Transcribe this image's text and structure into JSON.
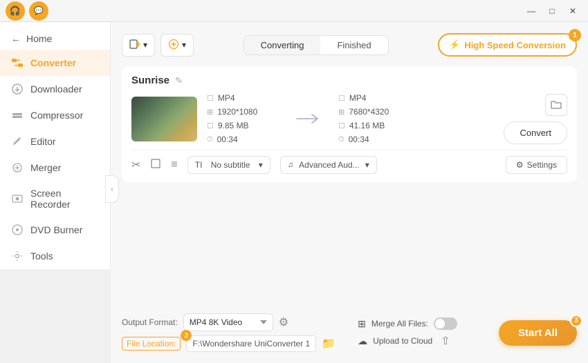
{
  "titlebar": {
    "icon1_label": "headphone-icon",
    "icon2_label": "message-icon",
    "minimize_label": "—",
    "maximize_label": "□",
    "close_label": "✕"
  },
  "sidebar": {
    "home_label": "Home",
    "items": [
      {
        "id": "converter",
        "label": "Converter",
        "icon": "⟳",
        "active": true
      },
      {
        "id": "downloader",
        "label": "Downloader",
        "icon": "↓"
      },
      {
        "id": "compressor",
        "label": "Compressor",
        "icon": "⊟"
      },
      {
        "id": "editor",
        "label": "Editor",
        "icon": "✏"
      },
      {
        "id": "merger",
        "label": "Merger",
        "icon": "⊕"
      },
      {
        "id": "screen-recorder",
        "label": "Screen Recorder",
        "icon": "▶"
      },
      {
        "id": "dvd-burner",
        "label": "DVD Burner",
        "icon": "💿"
      },
      {
        "id": "tools",
        "label": "Tools",
        "icon": "⚙"
      }
    ]
  },
  "header": {
    "add_btn_label": "Add",
    "add_more_label": "+",
    "tab_converting": "Converting",
    "tab_finished": "Finished",
    "high_speed_label": "High Speed Conversion",
    "high_speed_badge": "1",
    "bolt_icon": "⚡"
  },
  "file_card": {
    "title": "Sunrise",
    "source": {
      "format": "MP4",
      "resolution": "1920*1080",
      "size": "9.85 MB",
      "duration": "00:34"
    },
    "dest": {
      "format": "MP4",
      "resolution": "7680*4320",
      "size": "41.16 MB",
      "duration": "00:34"
    },
    "subtitle_label": "No subtitle",
    "audio_label": "Advanced Aud...",
    "settings_label": "Settings"
  },
  "bottom": {
    "output_format_label": "Output Format:",
    "output_format_value": "MP4 8K Video",
    "file_location_label": "File Location:",
    "file_location_value": "F:\\Wondershare UniConverter 1",
    "merge_all_label": "Merge All Files:",
    "upload_cloud_label": "Upload to Cloud",
    "start_all_label": "Start All",
    "start_all_badge": "3",
    "badge2_label": "2"
  }
}
